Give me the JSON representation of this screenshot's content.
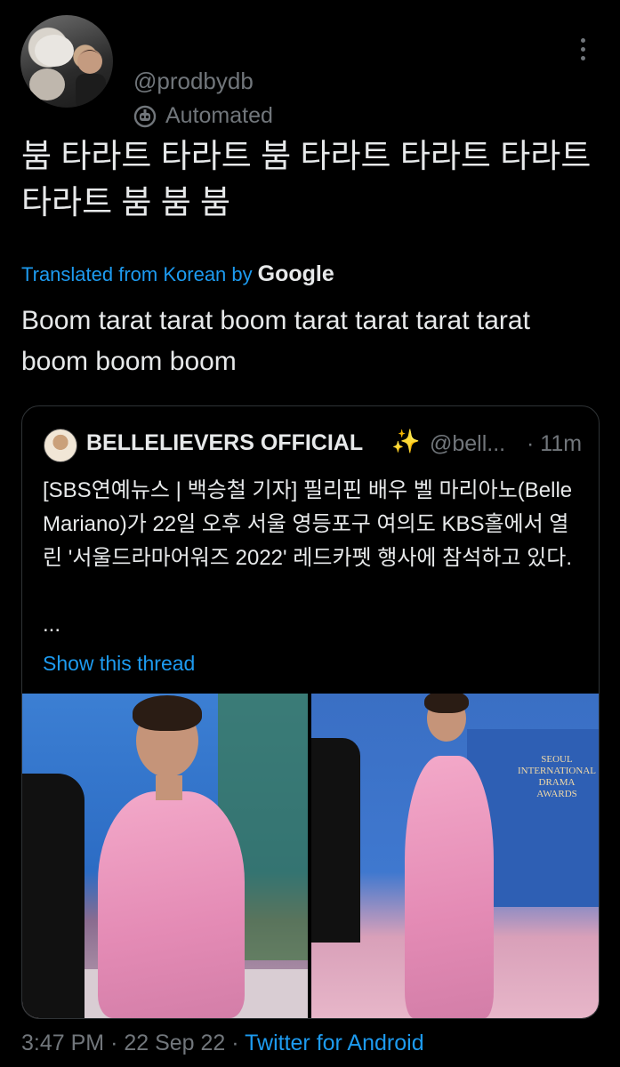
{
  "tweet": {
    "handle": "@prodbydb",
    "label": "Automated",
    "text": "붐 타라트 타라트 붐 타라트 타라트 타라트 타라트 붐 붐 붐",
    "translated_prefix": "Translated from Korean by",
    "translated_brand": "Google",
    "translation": "Boom tarat tarat boom tarat tarat tarat tarat boom boom boom",
    "time": "3:47 PM",
    "date": "22 Sep 22",
    "source": "Twitter for Android",
    "separator": "·"
  },
  "quote": {
    "name": "BELLELIEVERS OFFICIAL",
    "emoji": "✨",
    "handle": "@bell...",
    "time": "· 11m",
    "text": "[SBS연예뉴스 | 백승철 기자] 필리핀 배우 벨 마리아노(Belle Mariano)가 22일 오후 서울 영등포구 여의도 KBS홀에서 열린 '서울드라마어워즈 2022' 레드카펫 행사에 참석하고 있다.",
    "ellipsis": "...",
    "show_thread": "Show this thread",
    "photo2_sign": "SEOUL INTERNATIONAL DRAMA AWARDS"
  },
  "icons": {
    "more": "more-vertical-icon",
    "automated": "robot-icon"
  },
  "colors": {
    "background": "#000000",
    "text": "#e7e9ea",
    "secondary": "#71767b",
    "accent": "#1d9bf0"
  }
}
